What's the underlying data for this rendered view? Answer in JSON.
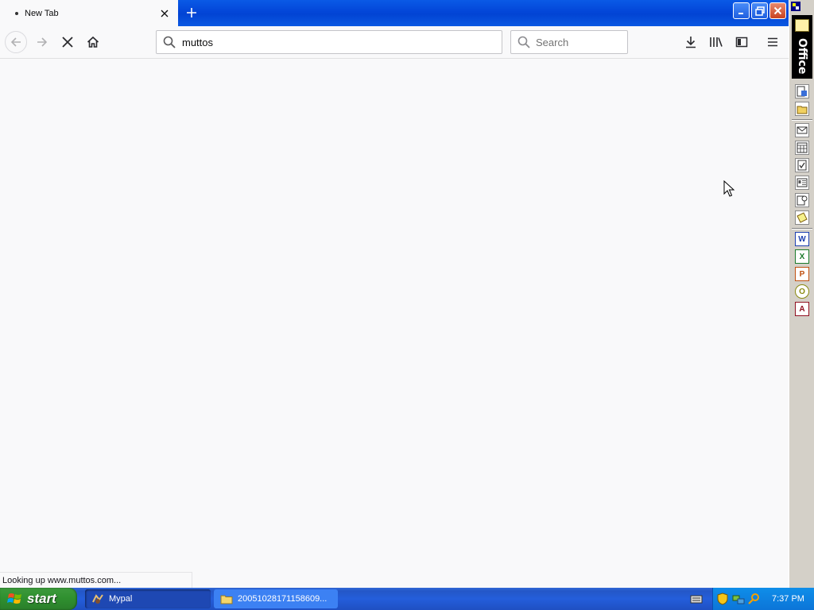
{
  "browser": {
    "tab": {
      "title": "New Tab"
    },
    "urlbar": {
      "value": "muttos"
    },
    "searchbar": {
      "placeholder": "Search"
    },
    "status_text": "Looking up www.muttos.com..."
  },
  "office_bar": {
    "label": "Office",
    "buttons": [
      {
        "name": "new-office-document",
        "glyph": ""
      },
      {
        "name": "open-office-document",
        "glyph": ""
      },
      {
        "name": "new-message",
        "glyph": "✉"
      },
      {
        "name": "new-appointment",
        "glyph": "▦"
      },
      {
        "name": "new-task",
        "glyph": "✓"
      },
      {
        "name": "new-contact",
        "glyph": "▤"
      },
      {
        "name": "new-journal-entry",
        "glyph": ""
      },
      {
        "name": "new-note",
        "glyph": ""
      },
      {
        "name": "microsoft-word",
        "glyph": "W"
      },
      {
        "name": "microsoft-excel",
        "glyph": "X"
      },
      {
        "name": "microsoft-powerpoint",
        "glyph": "P"
      },
      {
        "name": "microsoft-outlook",
        "glyph": "O"
      },
      {
        "name": "microsoft-access",
        "glyph": "A"
      }
    ]
  },
  "taskbar": {
    "start_label": "start",
    "tasks": [
      {
        "label": "Mypal"
      },
      {
        "label": "20051028171158609..."
      }
    ],
    "clock": "7:37 PM"
  },
  "colors": {
    "titlebar_blue": "#0346d8",
    "taskbar_blue": "#245edb",
    "start_green": "#2f8f2f",
    "close_red": "#c9421f"
  }
}
